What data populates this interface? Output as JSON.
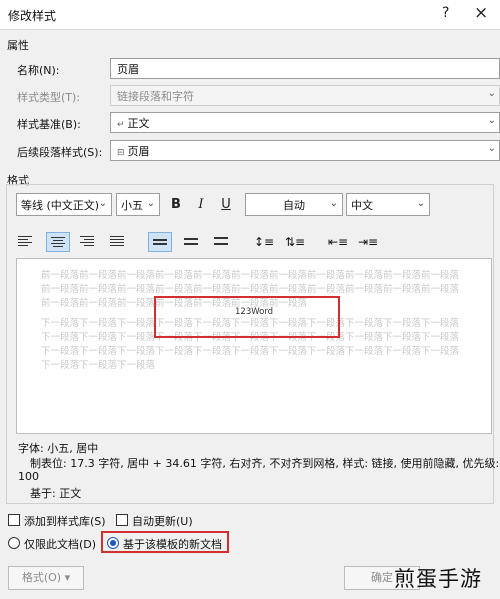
{
  "window": {
    "title": "修改样式",
    "help": "?",
    "close": "×"
  },
  "properties": {
    "section_label": "属性",
    "name": {
      "label": "名称(N):",
      "value": "页眉"
    },
    "style_type": {
      "label": "样式类型(T):",
      "value": "链接段落和字符"
    },
    "style_based_on": {
      "label": "样式基准(B):",
      "value": "正文",
      "mark": "↵"
    },
    "following_style": {
      "label": "后续段落样式(S):",
      "value": "页眉",
      "mark": "⊟"
    }
  },
  "format": {
    "section_label": "格式",
    "font": "等线 (中文正文)",
    "size": "小五",
    "bold": "B",
    "italic": "I",
    "underline": "U",
    "color": "自动",
    "script": "中文"
  },
  "preview": {
    "prev_paragraph": "前一段落前一段落前一段落前一段落前一段落前一段落前一段落前一段落前一段落前一段落前一段落前一段落前一段落前一段落前一段落前一段落前一段落前一段落前一段落前一段落前一段落前一段落前一段落前一段落前一段落前一段落前一段落前一段落前一段落",
    "sample_text": "123Word",
    "next_paragraph": "下一段落下一段落下一段落下一段落下一段落下一段落下一段落下一段落下一段落下一段落下一段落下一段落下一段落下一段落下一段落下一段落下一段落下一段落下一段落下一段落下一段落下一段落下一段落下一段落下一段落下一段落下一段落下一段落下一段落下一段落下一段落下一段落下一段落下一段落下一段落下一段落"
  },
  "description": {
    "line1": "字体: 小五, 居中",
    "line2": "制表位: 17.3 字符, 居中 + 34.61 字符, 右对齐, 不对齐到网格, 样式: 链接, 使用前隐藏, 优先级:",
    "line3": "100",
    "line4": "基于: 正文"
  },
  "options": {
    "add_to_gallery": {
      "label": "添加到样式库(S)",
      "checked": false
    },
    "auto_update": {
      "label": "自动更新(U)",
      "checked": false
    },
    "only_this_document": {
      "label": "仅限此文档(D)",
      "selected": false
    },
    "new_docs_template": {
      "label": "基于该模板的新文档",
      "selected": true
    }
  },
  "buttons": {
    "format": "格式(O)",
    "format_arrow": "▾",
    "ok": "确定"
  },
  "watermark": "煎蛋手游",
  "colors": {
    "highlight_red": "#d32f2f",
    "accent_blue": "#1a56c4",
    "active_button": "#cfe3f7"
  }
}
